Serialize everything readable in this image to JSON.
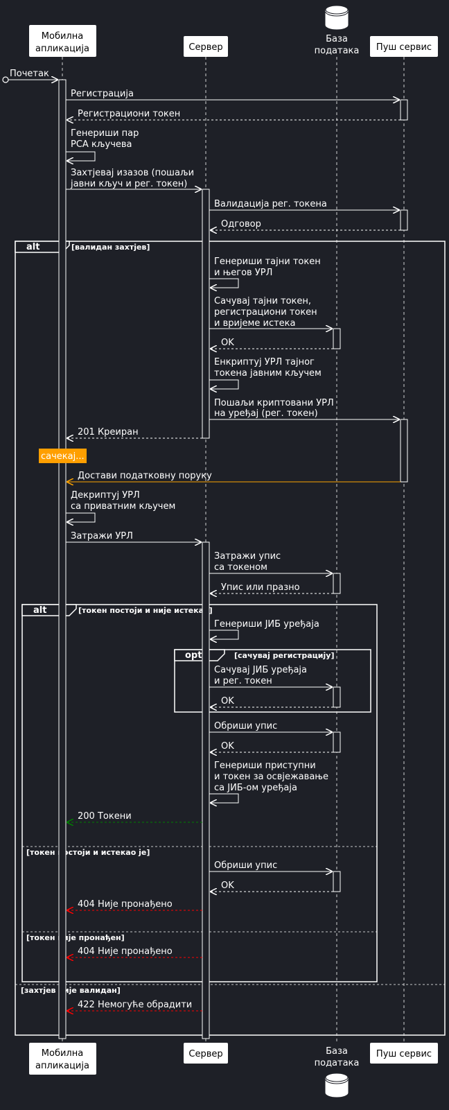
{
  "participants": {
    "mobile": {
      "line1": "Мобилна",
      "line2": "апликација"
    },
    "server": {
      "label": "Сервер"
    },
    "db": {
      "line1": "База",
      "line2": "података"
    },
    "push": {
      "label": "Пуш сервис"
    }
  },
  "messages": {
    "start": "Почетак",
    "m1": "Регистрација",
    "m2": "Регистрациони токен",
    "m3a": "Генериши пар",
    "m3b": "РСА кључева",
    "m4a": "Захтјевај изазов (пошаљи",
    "m4b": "јавни кључ и рег. токен)",
    "m5": "Валидација рег. токена",
    "m6": "Одговор",
    "m7a": "Генериши тајни токен",
    "m7b": "и његов УРЛ",
    "m8a": "Сачувај тајни токен,",
    "m8b": "регистрациони токен",
    "m8c": "и вријеме истека",
    "m9": "OK",
    "m10a": "Енкриптуј УРЛ тајног",
    "m10b": "токена јавним кључем",
    "m11a": "Пошаљи криптовани УРЛ",
    "m11b": "на уређај (рег. токен)",
    "m12": "201 Креиран",
    "m13": "Достави податковну поруку",
    "m14a": "Декриптуј УРЛ",
    "m14b": "са приватним кључем",
    "m15": "Затражи УРЛ",
    "m16a": "Затражи упис",
    "m16b": "са токеном",
    "m17": "Упис или празно",
    "m18": "Генериши ЈИБ уређаја",
    "m19a": "Сачувај ЈИБ уређаја",
    "m19b": "и рег. токен",
    "m20": "OK",
    "m21": "Обриши упис",
    "m22": "OK",
    "m23a": "Генериши приступни",
    "m23b": "и токен за освјежавање",
    "m23c": "са ЈИБ-ом уређаја",
    "m24": "200 Токени",
    "m25": "Обриши упис",
    "m26": "OK",
    "m27": "404 Није пронађено",
    "m28": "404 Није пронађено",
    "m29": "422 Немогуће обрадити"
  },
  "note": "сачекај...",
  "fragments": {
    "outer_alt": {
      "keyword": "alt",
      "guard1": "[валидан захтјев]",
      "guard2": "[захтјев није валидан]"
    },
    "inner_alt": {
      "keyword": "alt",
      "guard1": "[токен постоји и није истекао]",
      "guard2": "[токен постоји и истекао је]",
      "guard3": "[токен није пронађен]"
    },
    "opt": {
      "keyword": "opt",
      "guard1": "[сачувај регистрацију]"
    }
  },
  "colors": {
    "background": "#1e2027",
    "line": "#ffffff",
    "note_bg": "#ff9f00",
    "orange_arrow": "#ffa500",
    "success_arrow": "#008000",
    "error_arrow": "#ff0000"
  }
}
